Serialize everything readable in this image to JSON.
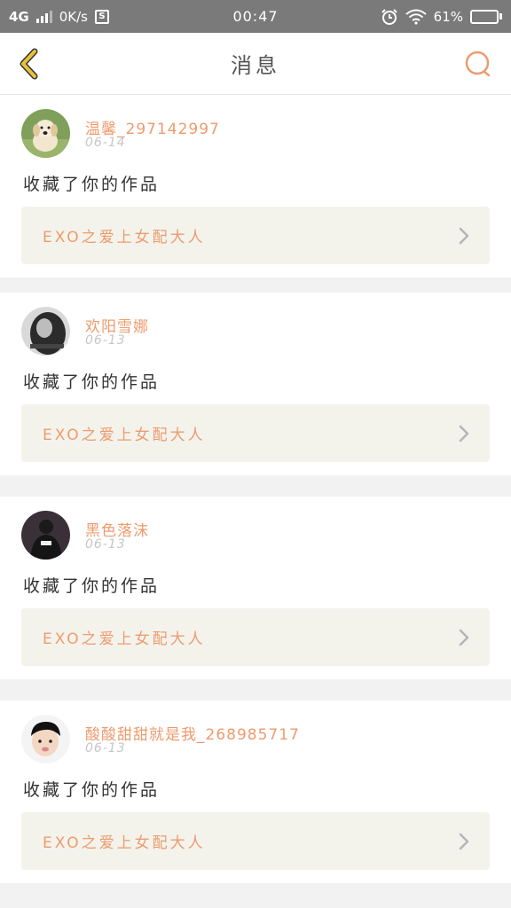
{
  "status_bar": {
    "network": "4G",
    "speed": "0K/s",
    "s_icon": "S",
    "time": "00:47",
    "battery": "61%",
    "battery_level": 0.61
  },
  "header": {
    "title": "消息",
    "back_icon": "chevron-left-icon",
    "search_icon": "search-icon"
  },
  "colors": {
    "accent": "#ee9b6e",
    "back_yellow": "#e8c13a",
    "card_bg": "#f3f3ec"
  },
  "messages": [
    {
      "username": "温馨_297142997",
      "date": "06-14",
      "action": "收藏了你的作品",
      "work_title": "EXO之爱上女配大人"
    },
    {
      "username": "欢阳雪娜",
      "date": "06-13",
      "action": "收藏了你的作品",
      "work_title": "EXO之爱上女配大人"
    },
    {
      "username": "黑色落沫",
      "date": "06-13",
      "action": "收藏了你的作品",
      "work_title": "EXO之爱上女配大人"
    },
    {
      "username": "酸酸甜甜就是我_268985717",
      "date": "06-13",
      "action": "收藏了你的作品",
      "work_title": "EXO之爱上女配大人"
    }
  ]
}
